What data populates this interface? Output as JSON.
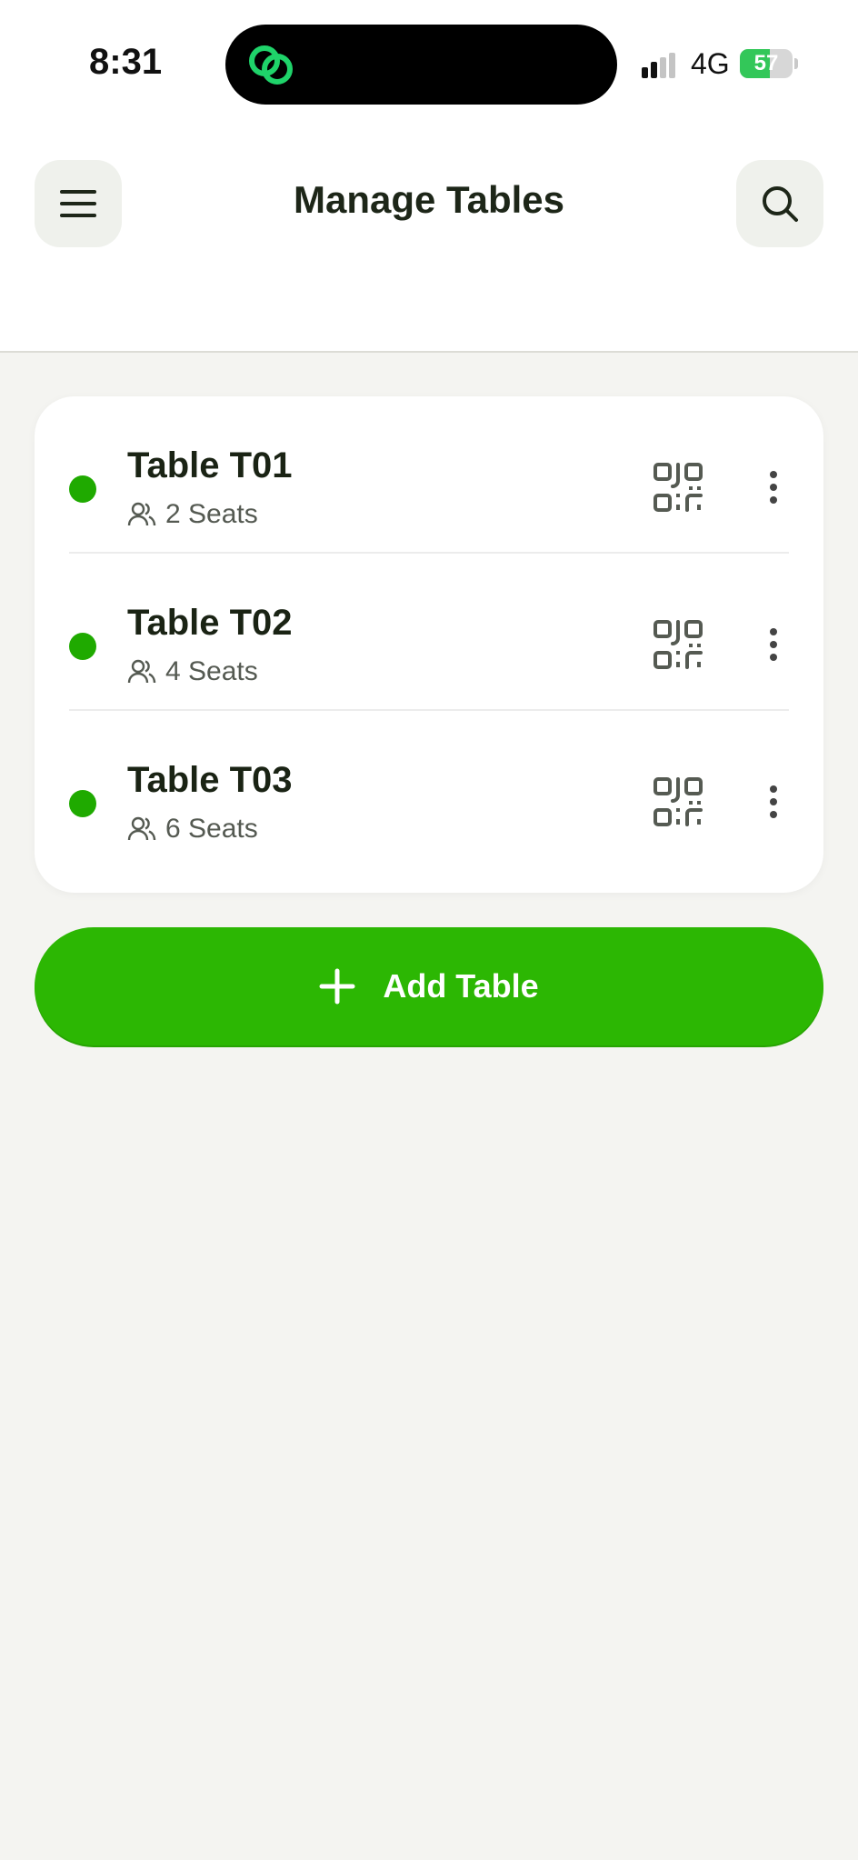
{
  "status_bar": {
    "time": "8:31",
    "network": "4G",
    "battery_percent": "57",
    "battery_level": 0.57
  },
  "header": {
    "title": "Manage Tables",
    "menu_icon": "hamburger-menu-icon",
    "search_icon": "search-icon"
  },
  "tables": [
    {
      "name": "Table T01",
      "seats": "2 Seats",
      "status_color": "#1faa00"
    },
    {
      "name": "Table T02",
      "seats": "4 Seats",
      "status_color": "#1faa00"
    },
    {
      "name": "Table T03",
      "seats": "6 Seats",
      "status_color": "#1faa00"
    }
  ],
  "add_button": {
    "label": "Add Table"
  },
  "colors": {
    "accent": "#2cb703",
    "status_active": "#1faa00",
    "background": "#f4f4f1"
  }
}
